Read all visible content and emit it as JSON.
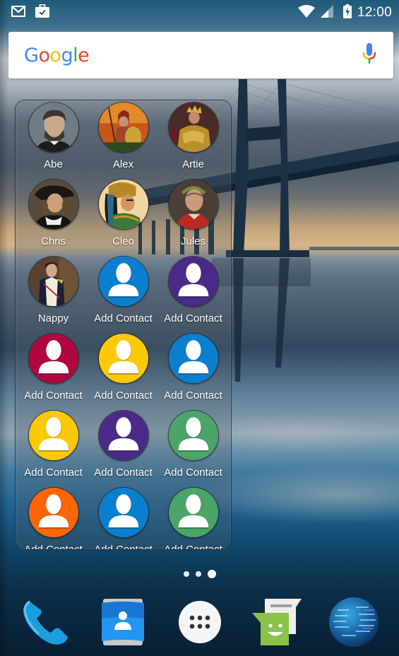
{
  "status_bar": {
    "notifications": [
      {
        "icon": "gmail-icon"
      },
      {
        "icon": "task-briefcase-icon"
      }
    ],
    "wifi_icon": "wifi-icon",
    "signal_icon": "cell-signal-icon",
    "battery_icon": "battery-charging-icon",
    "time": "12:00"
  },
  "search_bar": {
    "logo_letters": [
      "G",
      "o",
      "o",
      "g",
      "l",
      "e"
    ],
    "mic_icon": "microphone-icon"
  },
  "folder": {
    "contacts": [
      {
        "name": "Abe",
        "type": "photo",
        "photo": "abe"
      },
      {
        "name": "Alex",
        "type": "photo",
        "photo": "alex"
      },
      {
        "name": "Artie",
        "type": "photo",
        "photo": "artie"
      },
      {
        "name": "Chris",
        "type": "photo",
        "photo": "chris"
      },
      {
        "name": "Cleo",
        "type": "photo",
        "photo": "cleo"
      },
      {
        "name": "Jules",
        "type": "photo",
        "photo": "jules"
      },
      {
        "name": "Nappy",
        "type": "photo",
        "photo": "nappy"
      },
      {
        "name": "Add Contact",
        "type": "placeholder",
        "color": "#0a7fd0"
      },
      {
        "name": "Add Contact",
        "type": "placeholder",
        "color": "#4a2a86"
      },
      {
        "name": "Add Contact",
        "type": "placeholder",
        "color": "#b0073f"
      },
      {
        "name": "Add Contact",
        "type": "placeholder",
        "color": "#fdc806"
      },
      {
        "name": "Add Contact",
        "type": "placeholder",
        "color": "#0a7fd0"
      },
      {
        "name": "Add Contact",
        "type": "placeholder",
        "color": "#fdc806"
      },
      {
        "name": "Add Contact",
        "type": "placeholder",
        "color": "#4a2a86"
      },
      {
        "name": "Add Contact",
        "type": "placeholder",
        "color": "#4ba468"
      },
      {
        "name": "Add Contact",
        "type": "placeholder",
        "color": "#fd6506"
      },
      {
        "name": "Add Contact",
        "type": "placeholder",
        "color": "#0a7fd0"
      },
      {
        "name": "Add Contact",
        "type": "placeholder",
        "color": "#4ba468"
      }
    ]
  },
  "page_indicator": {
    "count": 3,
    "active_index": 2
  },
  "dock": [
    {
      "name": "Phone",
      "icon": "phone-icon"
    },
    {
      "name": "Contacts",
      "icon": "contacts-icon"
    },
    {
      "name": "All apps",
      "icon": "app-drawer-icon"
    },
    {
      "name": "Messenger",
      "icon": "messenger-icon"
    },
    {
      "name": "Browser",
      "icon": "globe-icon"
    }
  ]
}
